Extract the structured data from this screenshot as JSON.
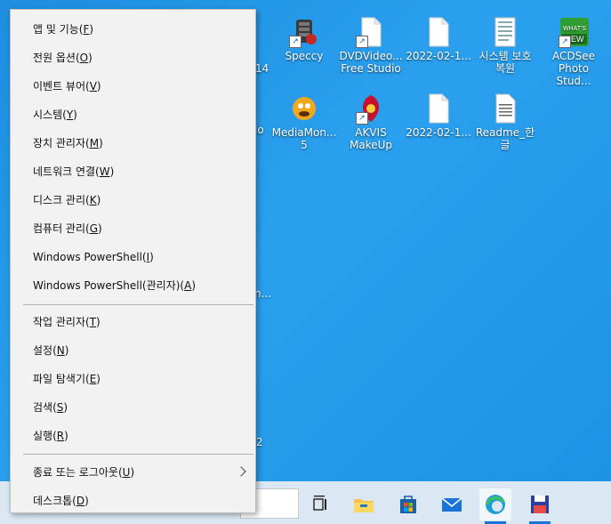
{
  "desktop": {
    "icons": [
      {
        "label": "Speccy",
        "icon": "speccy-icon",
        "shortcut": true
      },
      {
        "label": "DVDVideo...\nFree Studio",
        "icon": "dvdvideo-file-icon",
        "shortcut": true
      },
      {
        "label": "2022-02-1...",
        "icon": "blank-file-icon",
        "shortcut": false
      },
      {
        "label": "시스템 보호\n복원",
        "icon": "document-icon",
        "shortcut": false
      },
      {
        "label": "ACDSee\nPhoto Stud...",
        "icon": "acdsee-icon",
        "shortcut": true
      },
      {
        "label": "MediaMon...\n5",
        "icon": "mediamonkey-icon",
        "shortcut": false
      },
      {
        "label": "AKVIS\nMakeUp",
        "icon": "akvis-makeup-icon",
        "shortcut": true
      },
      {
        "label": "2022-02-1...",
        "icon": "blank-file-icon",
        "shortcut": false
      },
      {
        "label": "Readme_한글",
        "icon": "text-file-icon",
        "shortcut": false
      }
    ],
    "hidden_fragments": {
      "frag1": "14",
      "frag2": "io",
      "frag3": "n...",
      "frag4": "2"
    }
  },
  "menu": {
    "items": [
      {
        "text": "앱 및 기능(",
        "key": "F",
        "tail": ")"
      },
      {
        "text": "전원 옵션(",
        "key": "O",
        "tail": ")"
      },
      {
        "text": "이벤트 뷰어(",
        "key": "V",
        "tail": ")"
      },
      {
        "text": "시스템(",
        "key": "Y",
        "tail": ")"
      },
      {
        "text": "장치 관리자(",
        "key": "M",
        "tail": ")"
      },
      {
        "text": "네트워크 연결(",
        "key": "W",
        "tail": ")"
      },
      {
        "text": "디스크 관리(",
        "key": "K",
        "tail": ")"
      },
      {
        "text": "컴퓨터 관리(",
        "key": "G",
        "tail": ")"
      },
      {
        "text": "Windows PowerShell(",
        "key": "I",
        "tail": ")"
      },
      {
        "text": "Windows PowerShell(관리자)(",
        "key": "A",
        "tail": ")"
      },
      {
        "text": "작업 관리자(",
        "key": "T",
        "tail": ")"
      },
      {
        "text": "설정(",
        "key": "N",
        "tail": ")"
      },
      {
        "text": "파일 탐색기(",
        "key": "E",
        "tail": ")"
      },
      {
        "text": "검색(",
        "key": "S",
        "tail": ")"
      },
      {
        "text": "실행(",
        "key": "R",
        "tail": ")"
      },
      {
        "text": "종료 또는 로그아웃(",
        "key": "U",
        "tail": ")"
      },
      {
        "text": "데스크톱(",
        "key": "D",
        "tail": ")"
      }
    ]
  },
  "taskbar": {
    "buttons": [
      "task-view-icon",
      "file-explorer-icon",
      "microsoft-store-icon",
      "mail-icon",
      "edge-icon",
      "save-app-icon"
    ],
    "colors": {
      "accent": "#1a73d8",
      "background": "#dbe8f3"
    }
  }
}
